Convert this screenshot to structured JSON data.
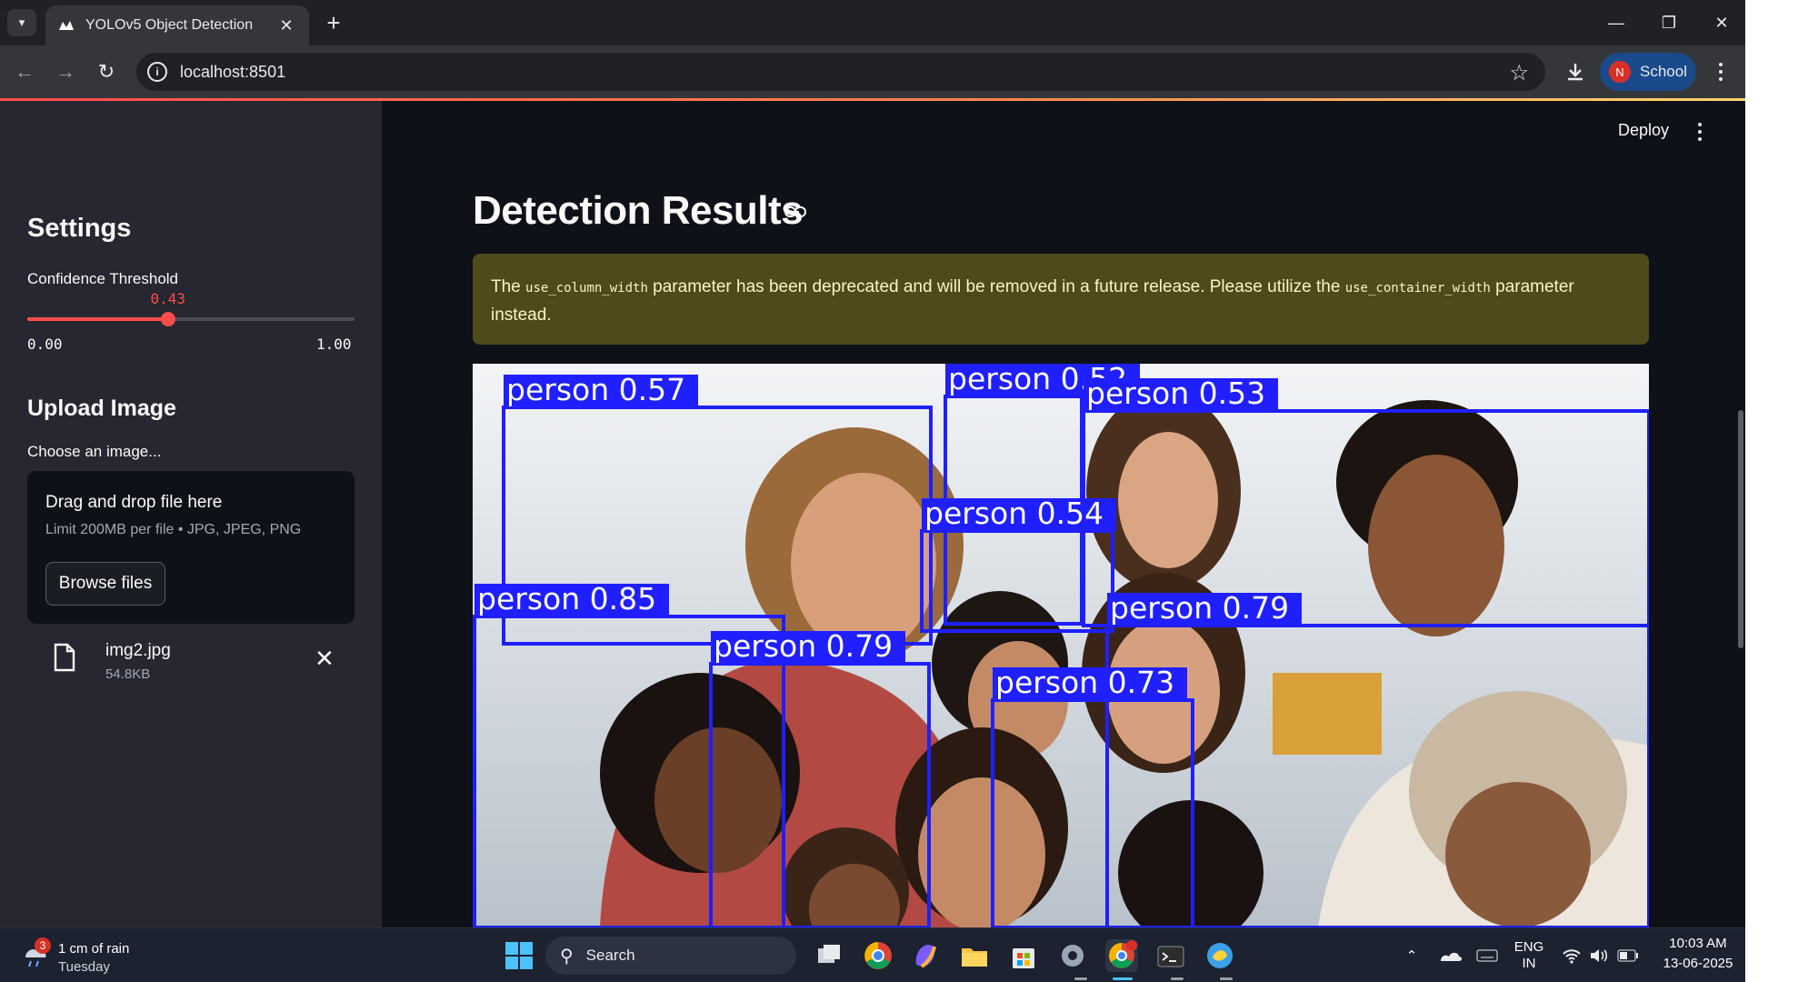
{
  "browser": {
    "tab_title": "YOLOv5 Object Detection",
    "url": "localhost:8501",
    "profile_initial": "N",
    "profile_name": "School"
  },
  "sidebar": {
    "settings_heading": "Settings",
    "confidence_label": "Confidence Threshold",
    "confidence_value": "0.43",
    "confidence_fraction": 0.43,
    "slider_min": "0.00",
    "slider_max": "1.00",
    "upload_heading": "Upload Image",
    "choose_label": "Choose an image...",
    "dropzone_title": "Drag and drop file here",
    "dropzone_limit": "Limit 200MB per file • JPG, JPEG, PNG",
    "browse_label": "Browse files",
    "file_name": "img2.jpg",
    "file_size": "54.8KB"
  },
  "main": {
    "deploy_label": "Deploy",
    "title": "Detection Results",
    "warning": {
      "prefix": "The ",
      "code1": "use_column_width",
      "middle": " parameter has been deprecated and will be removed in a future release. Please utilize the ",
      "code2": "use_container_width",
      "suffix": " parameter instead."
    },
    "detections": [
      {
        "label": "person 0.57"
      },
      {
        "label": "person 0.52"
      },
      {
        "label": "person 0.53"
      },
      {
        "label": "person 0.54"
      },
      {
        "label": "person 0.85"
      },
      {
        "label": "person 0.79"
      },
      {
        "label": "person 0.79"
      },
      {
        "label": "person 0.73"
      }
    ]
  },
  "taskbar": {
    "weather_badge": "3",
    "weather_line1": "1 cm of rain",
    "weather_line2": "Tuesday",
    "search_placeholder": "Search",
    "lang_line1": "ENG",
    "lang_line2": "IN",
    "time": "10:03 AM",
    "date": "13-06-2025"
  },
  "colors": {
    "accent": "#ff4b4b",
    "box": "#1f1fff",
    "warning_bg": "#4e4a19",
    "sidebar_bg": "#262730",
    "app_bg": "#0e1117"
  }
}
